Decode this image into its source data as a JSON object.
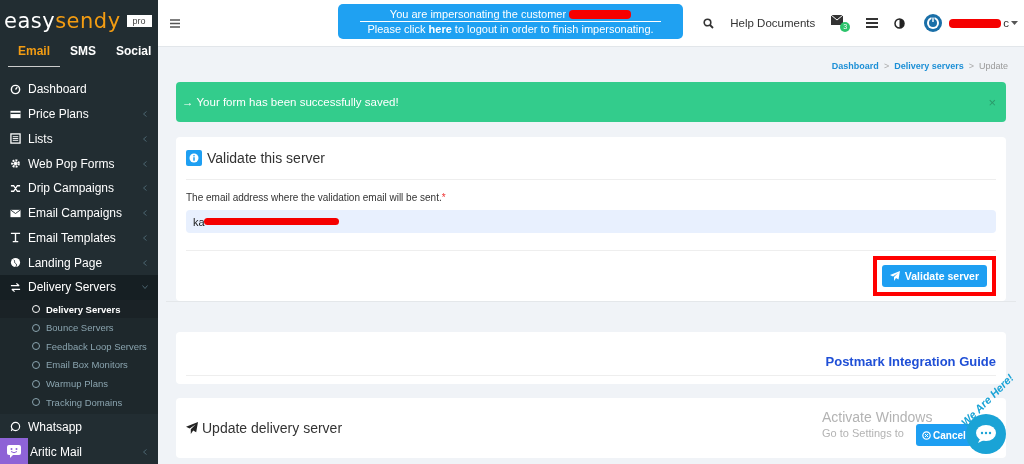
{
  "brand": {
    "name_dark": "easy",
    "name_accent": "sendy",
    "badge": "pro"
  },
  "channel_tabs": [
    {
      "label": "Email",
      "selected": true
    },
    {
      "label": "SMS",
      "selected": false
    },
    {
      "label": "Social",
      "selected": false
    }
  ],
  "sidebar": {
    "items": [
      {
        "label": "Dashboard",
        "has_submenu": false,
        "expanded": false
      },
      {
        "label": "Price Plans",
        "has_submenu": true,
        "expanded": false
      },
      {
        "label": "Lists",
        "has_submenu": true,
        "expanded": false
      },
      {
        "label": "Web Pop Forms",
        "has_submenu": true,
        "expanded": false
      },
      {
        "label": "Drip Campaigns",
        "has_submenu": true,
        "expanded": false
      },
      {
        "label": "Email Campaigns",
        "has_submenu": true,
        "expanded": false
      },
      {
        "label": "Email Templates",
        "has_submenu": true,
        "expanded": false
      },
      {
        "label": "Landing Page",
        "has_submenu": true,
        "expanded": false
      },
      {
        "label": "Delivery Servers",
        "has_submenu": true,
        "expanded": true,
        "children": [
          {
            "label": "Delivery Servers",
            "selected": true
          },
          {
            "label": "Bounce Servers",
            "selected": false
          },
          {
            "label": "Feedback Loop Servers",
            "selected": false
          },
          {
            "label": "Email Box Monitors",
            "selected": false
          },
          {
            "label": "Warmup Plans",
            "selected": false
          },
          {
            "label": "Tracking Domains",
            "selected": false
          }
        ]
      },
      {
        "label": "Whatsapp",
        "has_submenu": false,
        "expanded": false
      },
      {
        "label": "Aritic Mail",
        "has_submenu": true,
        "expanded": false
      }
    ]
  },
  "impersonation_banner": {
    "line_1": "You are impersonating the customer",
    "line_2_before": "Please click",
    "link": "here",
    "line_2_after": "to logout in order to finish impersonating."
  },
  "topbar": {
    "help": "Help Documents",
    "mail_count": "3",
    "user_suffix": "c"
  },
  "breadcrumb": [
    {
      "label": "Dashboard",
      "kind": "link"
    },
    {
      "label": ">",
      "kind": "separator"
    },
    {
      "label": "Delivery servers",
      "kind": "link"
    },
    {
      "label": ">",
      "kind": "separator"
    },
    {
      "label": "Update",
      "kind": "current"
    }
  ],
  "alert": {
    "message": "→ Your form has been successfully saved!",
    "close": "×"
  },
  "validate_panel": {
    "title": "Validate this server",
    "field_label": "The email address where the validation email will be sent.",
    "required_mark": "*",
    "value": "ka",
    "button": "Validate server",
    "highlighted": true
  },
  "guide_link": "Postmark Integration Guide",
  "update_panel": {
    "title": "Update delivery server",
    "cancel": "Cancel"
  },
  "os_notice": {
    "title": "Activate Windows",
    "text": "Go to Settings to"
  },
  "chat_widget": {
    "caption": "We Are Here!"
  }
}
